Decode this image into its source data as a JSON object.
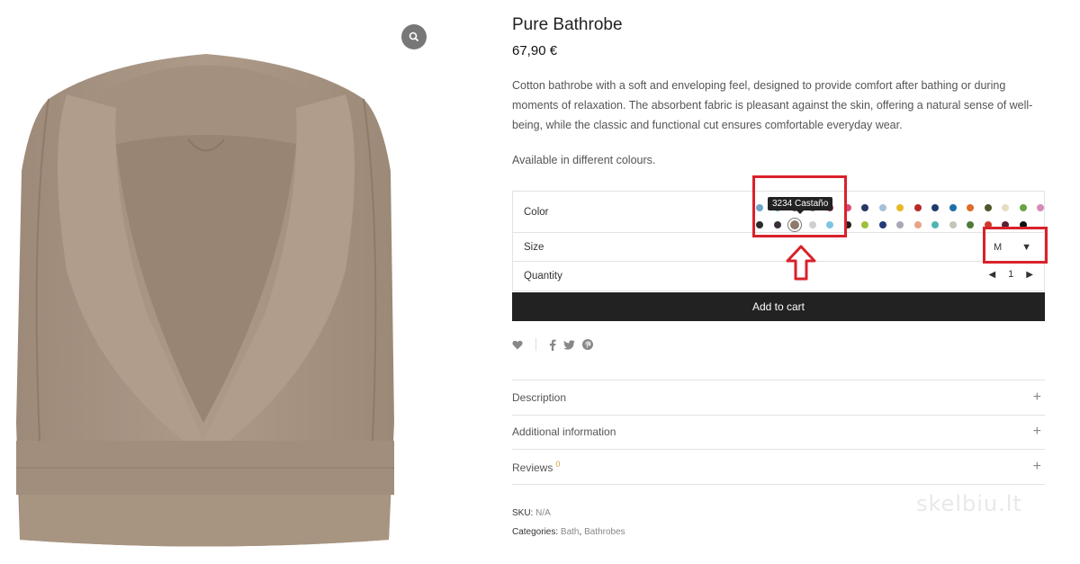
{
  "product": {
    "title": "Pure Bathrobe",
    "price": "67,90 €",
    "description": "Cotton bathrobe with a soft and enveloping feel, designed to provide comfort after bathing or during moments of relaxation. The absorbent fabric is pleasant against the skin, offering a natural sense of well-being, while the classic and functional cut ensures comfortable everyday wear.",
    "availability": "Available in different colours."
  },
  "variations": {
    "color_label": "Color",
    "color_tooltip": "3234 Castaño",
    "swatches_row1": [
      "#6fa3c9",
      "#5ba7c4",
      "#8b5a3c",
      "#9a7b6c",
      "#a03a5a",
      "#d94c7a",
      "#283862",
      "#a9bfd8",
      "#e6b928",
      "#b72b2b",
      "#1f3b6e",
      "#1e6fa8",
      "#e06a28",
      "#4c5a2a",
      "#e8dcc6",
      "#69a444",
      "#d48bb3"
    ],
    "swatches_row2": [
      "#2b2b2b",
      "#3a2f3a",
      "#8f7a6b",
      "#cfcfcf",
      "#7fc4e0",
      "#1e1e1e",
      "#9dc03a",
      "#243a78",
      "#a7a9b8",
      "#e8a487",
      "#4fb5b0",
      "#c2c7b8",
      "#4f7a3a",
      "#cf3a2a",
      "#5a2030",
      "#111111"
    ],
    "selected_swatch": "#8f7a6b",
    "size_label": "Size",
    "size_value": "M",
    "quantity_label": "Quantity",
    "quantity_value": "1"
  },
  "cart": {
    "button_label": "Add to cart"
  },
  "tabs": [
    {
      "label": "Description"
    },
    {
      "label": "Additional information"
    },
    {
      "label": "Reviews",
      "count": "0"
    }
  ],
  "meta": {
    "sku_label": "SKU:",
    "sku_value": "N/A",
    "categories_label": "Categories:",
    "category_1": "Bath",
    "category_2": "Bathrobes"
  },
  "watermark": "skelbiu.lt",
  "icons": [
    "search-icon",
    "heart-icon",
    "facebook-icon",
    "twitter-icon",
    "pinterest-icon",
    "chevron-down-icon",
    "arrow-up-icon"
  ],
  "colors": {
    "accent": "#d9222a",
    "robe": "#a89483",
    "button": "#222222"
  }
}
